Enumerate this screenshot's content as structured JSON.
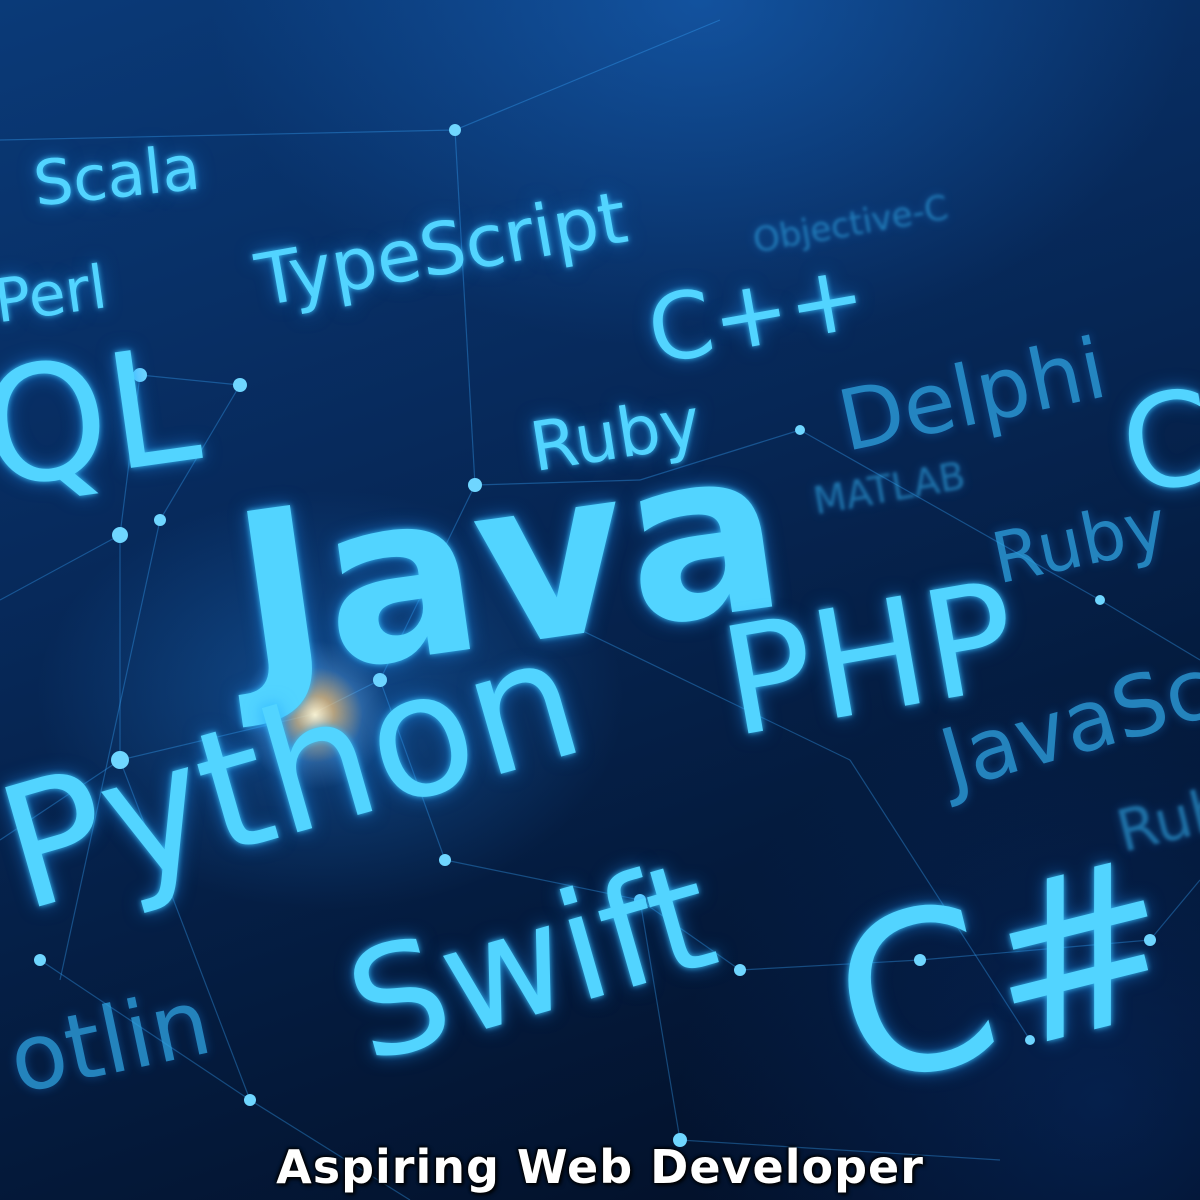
{
  "image": {
    "palette": {
      "background": "#04142e",
      "glow": "#52d4ff",
      "flare": "#fff5d2"
    }
  },
  "words": {
    "scala": "Scala",
    "perl": "Perl",
    "typescript": "TypeScript",
    "objective_c": "Objective-C",
    "cpp": "C++",
    "sql": "QL",
    "ruby_1": "Ruby",
    "delphi": "Delphi",
    "c": "C",
    "matlab": "MATLAB",
    "java": "Java",
    "ruby_2": "Ruby",
    "php": "PHP",
    "python": "Python",
    "javascript": "JavaScri",
    "ruby_3": "Rub",
    "swift": "Swift",
    "csharp": "C#",
    "kotlin": "otlin"
  },
  "caption": {
    "text": "Aspiring Web Developer"
  }
}
